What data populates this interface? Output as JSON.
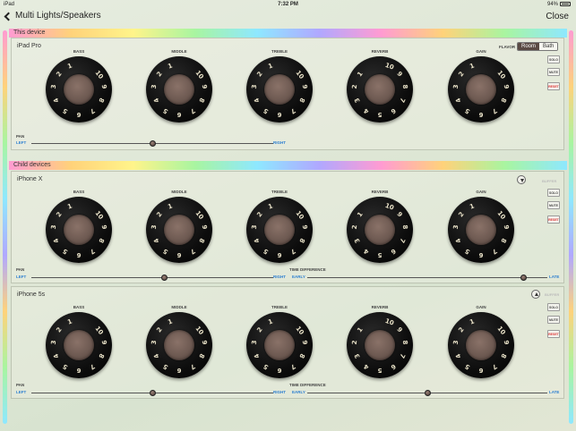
{
  "status_bar": {
    "carrier": "iPad",
    "time": "7:32 PM",
    "battery": "94%"
  },
  "nav": {
    "back_label": "Multi Lights/Speakers",
    "close_label": "Close"
  },
  "knob_labels": [
    "BASS",
    "MIDDLE",
    "TREBLE",
    "REVERB",
    "GAIN"
  ],
  "buttons": {
    "solo": "SOLO",
    "mute": "MUTE",
    "reset": "RESET",
    "buffer": "BUFFER"
  },
  "slider_text": {
    "pan": "PAN",
    "left": "LEFT",
    "right": "RIGHT",
    "time_difference": "TIME DIFFERENCE",
    "early": "EARLY",
    "late": "LATE"
  },
  "this_device": {
    "header": "This device",
    "name": "iPad Pro",
    "flavor_label": "FLAVOR",
    "flavor_options": [
      "Room",
      "Bath"
    ],
    "flavor_selected": "Room",
    "pan": 0.5
  },
  "child_devices": {
    "header": "Child devices",
    "devices": [
      {
        "name": "iPhone X",
        "pan": 0.55,
        "time_difference": 0.9
      },
      {
        "name": "iPhone 5s",
        "pan": 0.5,
        "time_difference": 0.5
      }
    ]
  },
  "colors": {
    "accent_blue": "#2d7fd0",
    "reset_red": "#dd3333",
    "selected_segment": "#5a4a44"
  }
}
